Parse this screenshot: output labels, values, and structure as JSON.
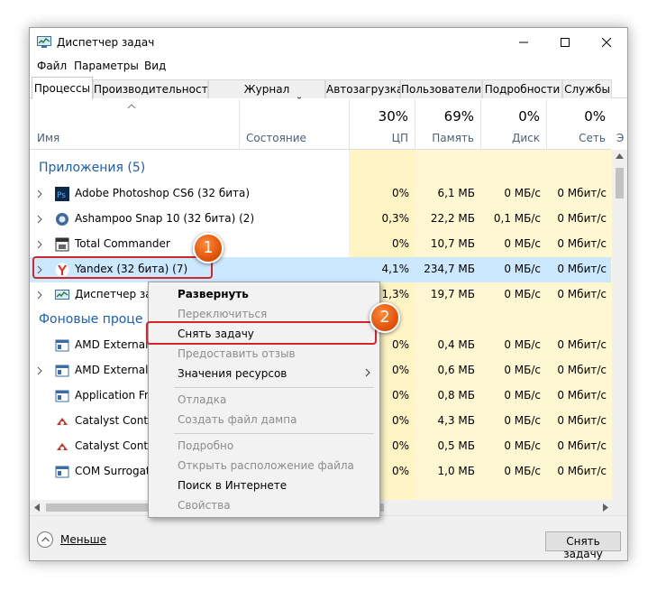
{
  "window": {
    "title": "Диспетчер задач"
  },
  "menu": [
    "Файл",
    "Параметры",
    "Вид"
  ],
  "tabs": [
    "Процессы",
    "Производительность",
    "Журнал приложений",
    "Автозагрузка",
    "Пользователи",
    "Подробности",
    "Службы"
  ],
  "columns": {
    "name": "Имя",
    "status": "Состояние",
    "cpu": {
      "pct": "30%",
      "label": "ЦП"
    },
    "memory": {
      "pct": "69%",
      "label": "Память"
    },
    "disk": {
      "pct": "0%",
      "label": "Диск"
    },
    "net": {
      "pct": "0%",
      "label": "Сеть"
    },
    "extra_label": "Э"
  },
  "groups": {
    "apps": "Приложения (5)",
    "background": "Фоновые проце"
  },
  "rows": [
    {
      "name": "Adobe Photoshop CS6 (32 бита)",
      "cpu": "0%",
      "mem": "6,1 МБ",
      "disk": "0 МБ/с",
      "net": "0 Мбит/с",
      "icon": "photoshop-icon"
    },
    {
      "name": "Ashampoo Snap 10 (32 бита) (2)",
      "cpu": "0,3%",
      "mem": "22,2 МБ",
      "disk": "0,1 МБ/с",
      "net": "0 Мбит/с",
      "icon": "ashampoo-icon"
    },
    {
      "name": "Total Commander",
      "cpu": "0%",
      "mem": "10,7 МБ",
      "disk": "0 МБ/с",
      "net": "0 Мбит/с",
      "icon": "total-commander-icon"
    },
    {
      "name": "Yandex (32 бита) (7)",
      "cpu": "4,1%",
      "mem": "234,7 МБ",
      "disk": "0 МБ/с",
      "net": "0 Мбит/с",
      "icon": "yandex-icon"
    },
    {
      "name": "Диспетчер задач",
      "cpu": "1,3%",
      "mem": "19,7 МБ",
      "disk": "0 МБ/с",
      "net": "0 Мбит/с",
      "icon": "task-manager-icon"
    },
    {
      "name": "AMD External E",
      "cpu": "0%",
      "mem": "0,4 МБ",
      "disk": "0 МБ/с",
      "net": "0 Мбит/с",
      "icon": "service-icon"
    },
    {
      "name": "AMD External E",
      "cpu": "0%",
      "mem": "0,6 МБ",
      "disk": "0 МБ/с",
      "net": "0 Мбит/с",
      "icon": "service-icon"
    },
    {
      "name": "Application Fra",
      "cpu": "0%",
      "mem": "0,8 МБ",
      "disk": "0 МБ/с",
      "net": "0 Мбит/с",
      "icon": "service-icon"
    },
    {
      "name": "Catalyst Contro",
      "cpu": "0%",
      "mem": "4,3 МБ",
      "disk": "0 МБ/с",
      "net": "0 Мбит/с",
      "icon": "catalyst-icon"
    },
    {
      "name": "Catalyst Contro",
      "cpu": "0%",
      "mem": "0,5 МБ",
      "disk": "0 МБ/с",
      "net": "0 Мбит/с",
      "icon": "catalyst-icon"
    },
    {
      "name": "COM Surrogate",
      "cpu": "0%",
      "mem": "1,0 МБ",
      "disk": "0 МБ/с",
      "net": "0 Мбит/с",
      "icon": "service-icon"
    }
  ],
  "context_menu": [
    {
      "label": "Развернуть",
      "style": "bold"
    },
    {
      "label": "Переключиться",
      "style": "disabled"
    },
    {
      "label": "Снять задачу",
      "style": "normal"
    },
    {
      "label": "Предоставить отзыв",
      "style": "disabled"
    },
    {
      "label": "Значения ресурсов",
      "style": "normal"
    },
    {
      "label": "Отладка",
      "style": "disabled"
    },
    {
      "label": "Создать файл дампа",
      "style": "disabled"
    },
    {
      "label": "Подробно",
      "style": "disabled"
    },
    {
      "label": "Открыть расположение файла",
      "style": "disabled"
    },
    {
      "label": "Поиск в Интернете",
      "style": "normal"
    },
    {
      "label": "Свойства",
      "style": "disabled"
    }
  ],
  "footer": {
    "less": "Меньше",
    "end_task": "Снять задачу"
  },
  "badges": [
    "1",
    "2"
  ],
  "colors": {
    "highlight": "#d1262a",
    "badge": "#e2560c",
    "selection": "#cce8ff",
    "shade": "#fff4c4",
    "group": "#1a5fb4"
  }
}
